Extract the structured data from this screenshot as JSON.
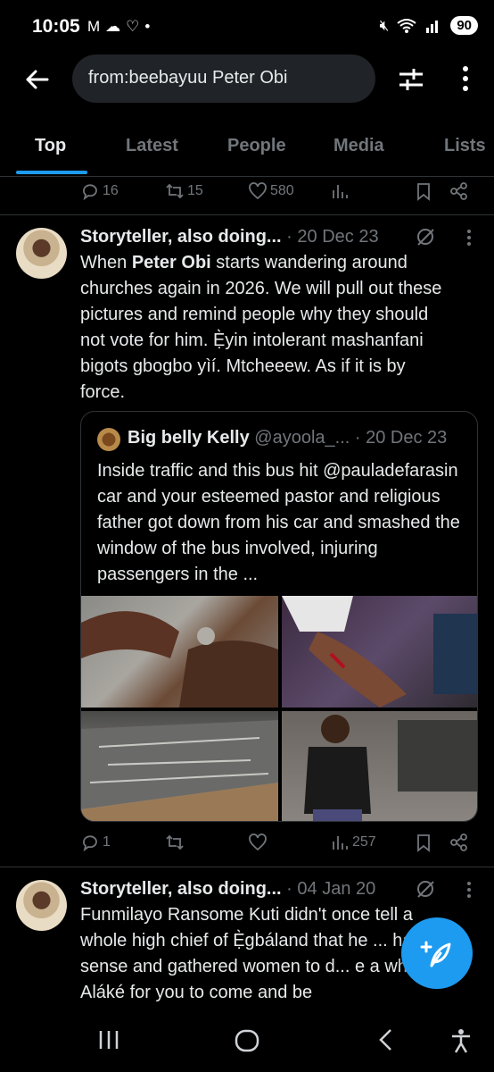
{
  "status_bar": {
    "time": "10:05",
    "battery": "90"
  },
  "search": {
    "query": "from:beebayuu Peter Obi"
  },
  "tabs": [
    {
      "label": "Top",
      "active": true
    },
    {
      "label": "Latest",
      "active": false
    },
    {
      "label": "People",
      "active": false
    },
    {
      "label": "Media",
      "active": false
    },
    {
      "label": "Lists",
      "active": false
    }
  ],
  "prev_tweet_actions": {
    "replies": "16",
    "reposts": "15",
    "likes": "580",
    "views": ""
  },
  "tweet1": {
    "author": "Storyteller, also doing...",
    "meta": "· 20 Dec 23",
    "text_bold": "Peter Obi",
    "text_before": "When ",
    "text_after": " starts wandering around churches again in 2026. We will pull out these pictures and remind people why they should not vote for him. Ẹ̀yin intolerant mashanfani bigots gbogbo yìí. Mtcheeew. As if it is by force.",
    "quote": {
      "author": "Big belly Kelly",
      "meta": "@ayoola_... · 20 Dec 23",
      "text": "Inside traffic and this bus hit @pauladefarasin car and your esteemed pastor and religious father got down from his car and smashed the window of the bus involved, injuring passengers in the ..."
    },
    "actions": {
      "replies": "1",
      "reposts": "",
      "likes": "",
      "views": "257"
    }
  },
  "tweet2": {
    "author": "Storyteller, also doing...",
    "meta": "· 04 Jan 20",
    "text": "Funmilayo Ransome Kuti didn't once tell a whole high chief of Ẹ̀gbáland that he ... have sense and gathered women to d... e a whole Aláké  for you to come and be"
  }
}
